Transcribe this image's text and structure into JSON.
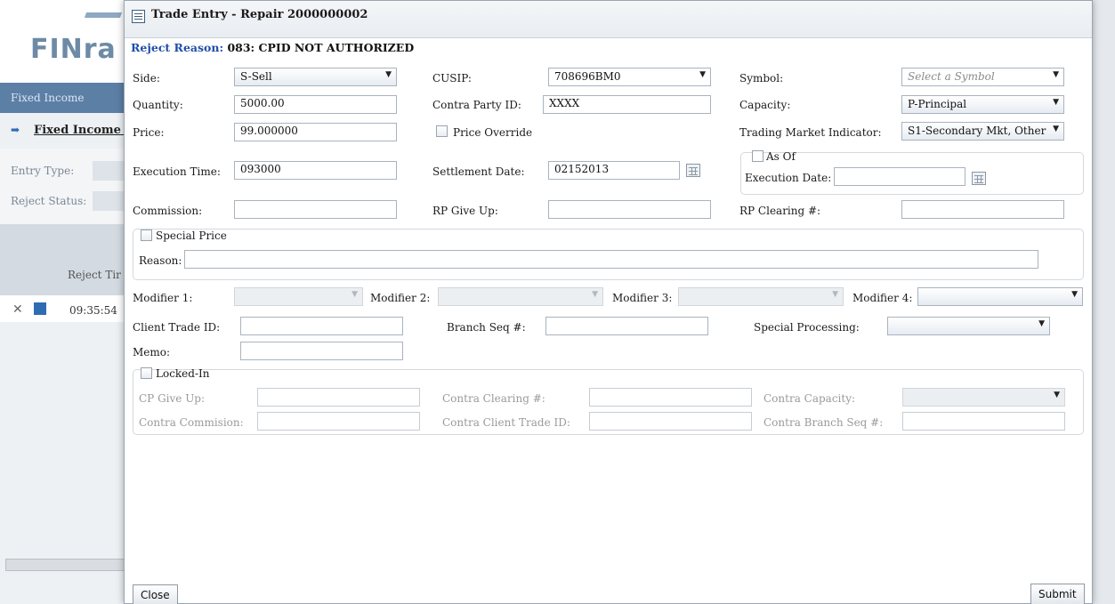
{
  "background": {
    "logo": "FINra",
    "tab": "Fixed Income",
    "breadcrumb": "Fixed Income /",
    "entry_type_label": "Entry Type:",
    "reject_status_label": "Reject Status:",
    "reject_time_header": "Reject Tir",
    "row_time": "09:35:54"
  },
  "dialog": {
    "title": "Trade Entry - Repair 2000000002",
    "reject_reason_label": "Reject Reason:",
    "reject_reason_value": "083: CPID NOT AUTHORIZED"
  },
  "form": {
    "side": {
      "label": "Side:",
      "value": "S-Sell"
    },
    "cusip": {
      "label": "CUSIP:",
      "value": "708696BM0"
    },
    "symbol": {
      "label": "Symbol:",
      "placeholder": "Select a Symbol"
    },
    "quantity": {
      "label": "Quantity:",
      "value": "5000.00"
    },
    "contra_party_id": {
      "label": "Contra Party ID:",
      "value": "XXXX"
    },
    "capacity": {
      "label": "Capacity:",
      "value": "P-Principal"
    },
    "price": {
      "label": "Price:",
      "value": "99.000000"
    },
    "price_override": {
      "label": "Price Override"
    },
    "trading_market_indicator": {
      "label": "Trading Market Indicator:",
      "value": "S1-Secondary Mkt, Other"
    },
    "execution_time": {
      "label": "Execution Time:",
      "value": "093000"
    },
    "settlement_date": {
      "label": "Settlement Date:",
      "value": "02152013"
    },
    "as_of": {
      "label": "As Of"
    },
    "execution_date": {
      "label": "Execution Date:",
      "value": ""
    },
    "commission": {
      "label": "Commission:",
      "value": ""
    },
    "rp_give_up": {
      "label": "RP Give Up:",
      "value": ""
    },
    "rp_clearing": {
      "label": "RP Clearing #:",
      "value": ""
    },
    "special_price": {
      "label": "Special Price"
    },
    "reason": {
      "label": "Reason:",
      "value": ""
    },
    "modifier1": {
      "label": "Modifier 1:"
    },
    "modifier2": {
      "label": "Modifier 2:"
    },
    "modifier3": {
      "label": "Modifier 3:"
    },
    "modifier4": {
      "label": "Modifier 4:"
    },
    "client_trade_id": {
      "label": "Client Trade ID:",
      "value": ""
    },
    "branch_seq": {
      "label": "Branch Seq #:",
      "value": ""
    },
    "special_processing": {
      "label": "Special Processing:"
    },
    "memo": {
      "label": "Memo:",
      "value": ""
    },
    "locked_in": {
      "label": "Locked-In"
    },
    "cp_give_up": {
      "label": "CP Give Up:"
    },
    "contra_clearing": {
      "label": "Contra Clearing #:"
    },
    "contra_capacity": {
      "label": "Contra Capacity:"
    },
    "contra_commission": {
      "label": "Contra Commision:"
    },
    "contra_client_trade_id": {
      "label": "Contra Client Trade ID:"
    },
    "contra_branch_seq": {
      "label": "Contra Branch Seq #:"
    }
  },
  "buttons": {
    "close": "Close",
    "submit": "Submit"
  }
}
